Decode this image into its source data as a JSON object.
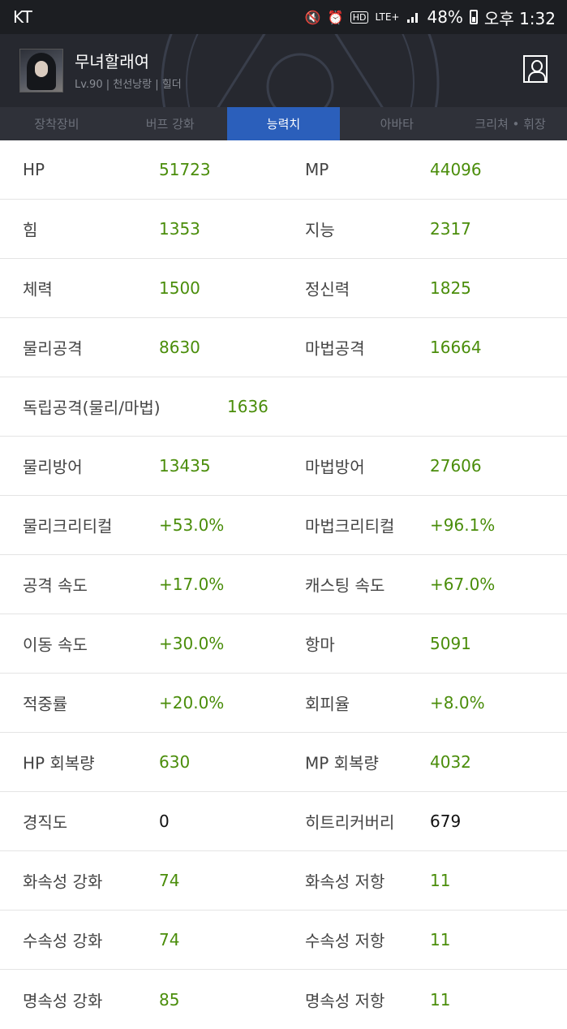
{
  "status_bar": {
    "carrier": "KT",
    "network": "LTE+",
    "battery": "48%",
    "time": "오후 1:32"
  },
  "profile": {
    "name": "무녀할래여",
    "info": "Lv.90 | 천선낭랑 | 힐더"
  },
  "tabs": [
    {
      "label": "장착장비",
      "active": false
    },
    {
      "label": "버프 강화",
      "active": false
    },
    {
      "label": "능력치",
      "active": true
    },
    {
      "label": "아바타",
      "active": false
    },
    {
      "label": "크리쳐 • 휘장",
      "active": false
    }
  ],
  "stats": [
    {
      "l1": "HP",
      "v1": "51723",
      "l2": "MP",
      "v2": "44096"
    },
    {
      "l1": "힘",
      "v1": "1353",
      "l2": "지능",
      "v2": "2317"
    },
    {
      "l1": "체력",
      "v1": "1500",
      "l2": "정신력",
      "v2": "1825"
    },
    {
      "l1": "물리공격",
      "v1": "8630",
      "l2": "마법공격",
      "v2": "16664"
    },
    {
      "l1": "독립공격(물리/마법)",
      "v1": "1636"
    },
    {
      "l1": "물리방어",
      "v1": "13435",
      "l2": "마법방어",
      "v2": "27606"
    },
    {
      "l1": "물리크리티컬",
      "v1": "+53.0%",
      "l2": "마법크리티컬",
      "v2": "+96.1%"
    },
    {
      "l1": "공격 속도",
      "v1": "+17.0%",
      "l2": "캐스팅 속도",
      "v2": "+67.0%"
    },
    {
      "l1": "이동 속도",
      "v1": "+30.0%",
      "l2": "항마",
      "v2": "5091"
    },
    {
      "l1": "적중률",
      "v1": "+20.0%",
      "l2": "회피율",
      "v2": "+8.0%"
    },
    {
      "l1": "HP 회복량",
      "v1": "630",
      "l2": "MP 회복량",
      "v2": "4032"
    },
    {
      "l1": "경직도",
      "v1": "0",
      "l2": "히트리커버리",
      "v2": "679"
    },
    {
      "l1": "화속성 강화",
      "v1": "74",
      "l2": "화속성 저항",
      "v2": "11"
    },
    {
      "l1": "수속성 강화",
      "v1": "74",
      "l2": "수속성 저항",
      "v2": "11"
    },
    {
      "l1": "명속성 강화",
      "v1": "85",
      "l2": "명속성 저항",
      "v2": "11"
    }
  ],
  "colors": {
    "value_green": "#4a8d0a",
    "tab_active": "#2b5fbb",
    "header_bg": "#26282f"
  }
}
